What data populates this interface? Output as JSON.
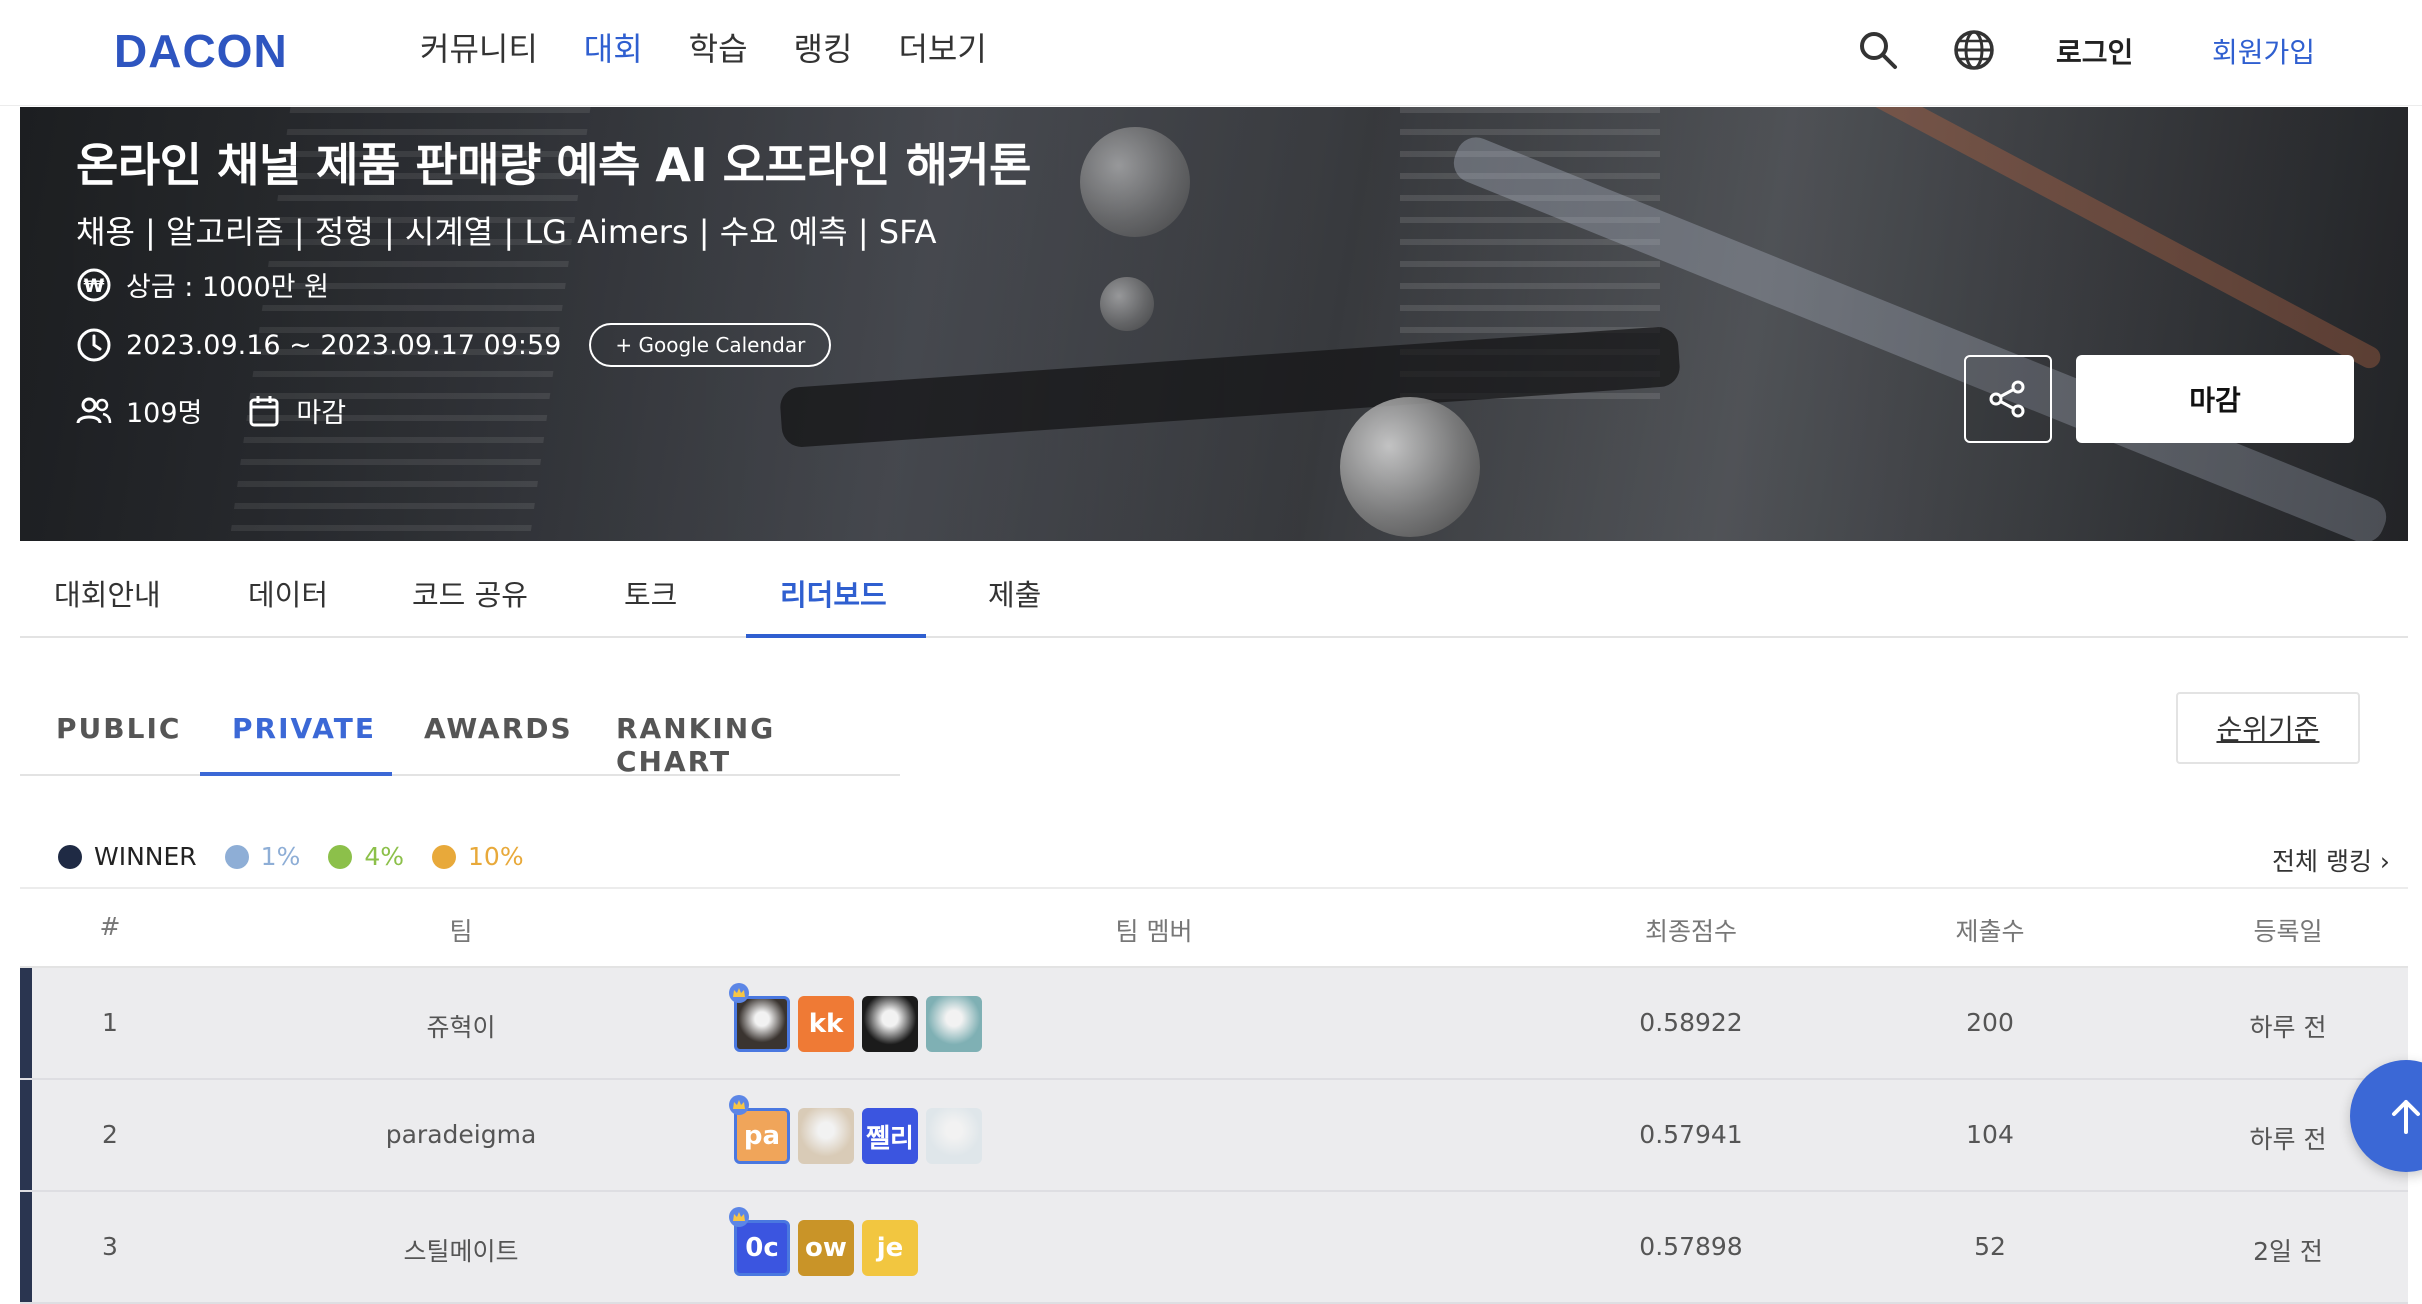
{
  "header": {
    "logo": "DACON",
    "nav": [
      "커뮤니티",
      "대회",
      "학습",
      "랭킹",
      "더보기"
    ],
    "nav_active": "대회",
    "login_label": "로그인",
    "signup_label": "회원가입",
    "accent_color": "#2f5fd0"
  },
  "hero": {
    "title": "온라인 채널 제품 판매량 예측 AI 오프라인 해커톤",
    "tags": "채용 | 알고리즘 | 정형 | 시계열 | LG Aimers | 수요 예측 | SFA",
    "prize": "상금 : 1000만 원",
    "period": "2023.09.16 ~ 2023.09.17 09:59",
    "calendar_button": "+ Google Calendar",
    "participants": "109명",
    "status": "마감",
    "action_button": "마감"
  },
  "main_tabs": [
    "대회안내",
    "데이터",
    "코드 공유",
    "토크",
    "리더보드",
    "제출"
  ],
  "main_tab_active": "리더보드",
  "sub_tabs": [
    "PUBLIC",
    "PRIVATE",
    "AWARDS",
    "RANKING CHART"
  ],
  "sub_tab_active": "PRIVATE",
  "criteria_button": "순위기준",
  "legend": [
    {
      "label": "WINNER",
      "color": "#1f2a44"
    },
    {
      "label": "1%",
      "color": "#8eaed6"
    },
    {
      "label": "4%",
      "color": "#8cc04a"
    },
    {
      "label": "10%",
      "color": "#e8a93a"
    }
  ],
  "full_ranking_link": "전체 랭킹 ›",
  "table": {
    "columns": [
      "#",
      "팀",
      "팀 멤버",
      "최종점수",
      "제출수",
      "등록일"
    ],
    "rows": [
      {
        "rank": "1",
        "team": "쥬혁이",
        "score": "0.58922",
        "submissions": "200",
        "registered": "하루 전",
        "members": [
          {
            "text": "",
            "color": "#3a3430",
            "kind": "photo"
          },
          {
            "text": "kk",
            "color": "#ef7a35",
            "kind": "initials"
          },
          {
            "text": "",
            "color": "#1b1b1b",
            "kind": "photo"
          },
          {
            "text": "",
            "color": "#7fb0b4",
            "kind": "photo"
          }
        ]
      },
      {
        "rank": "2",
        "team": "paradeigma",
        "score": "0.57941",
        "submissions": "104",
        "registered": "하루 전",
        "members": [
          {
            "text": "pa",
            "color": "#f0a55a",
            "kind": "initials"
          },
          {
            "text": "",
            "color": "#d9cbb7",
            "kind": "photo"
          },
          {
            "text": "쩰리",
            "color": "#3b55e0",
            "kind": "initials"
          },
          {
            "text": "",
            "color": "#dfe6ea",
            "kind": "photo"
          }
        ]
      },
      {
        "rank": "3",
        "team": "스틸메이트",
        "score": "0.57898",
        "submissions": "52",
        "registered": "2일 전",
        "members": [
          {
            "text": "0c",
            "color": "#3b55e0",
            "kind": "initials"
          },
          {
            "text": "ow",
            "color": "#c99428",
            "kind": "initials"
          },
          {
            "text": "je",
            "color": "#f2c640",
            "kind": "initials"
          }
        ]
      }
    ]
  }
}
